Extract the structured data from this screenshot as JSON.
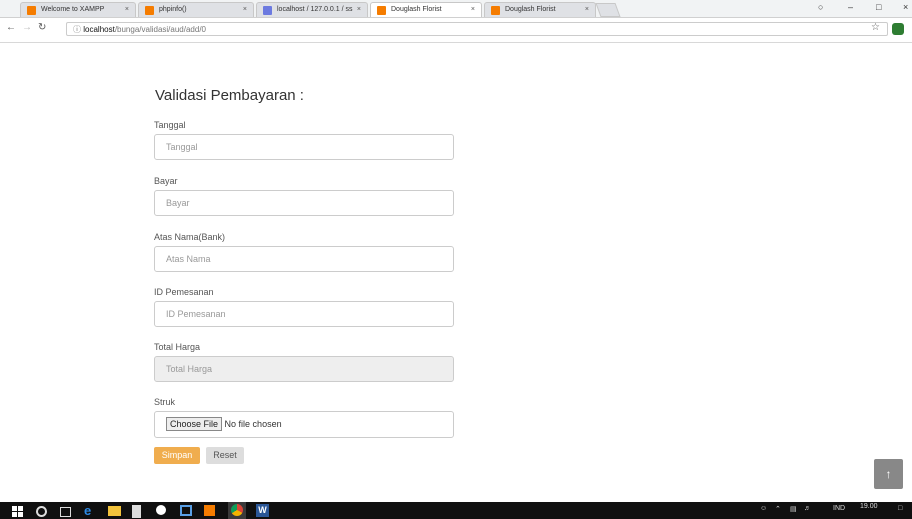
{
  "browser": {
    "tabs": [
      {
        "label": "Welcome to XAMPP",
        "active": false,
        "icon": "xampp-icon"
      },
      {
        "label": "phpinfo()",
        "active": false,
        "icon": "xampp-icon"
      },
      {
        "label": "localhost / 127.0.0.1 / ss",
        "active": false,
        "icon": "phpmyadmin-icon"
      },
      {
        "label": "Douglash Florist",
        "active": true,
        "icon": "xampp-icon"
      },
      {
        "label": "Douglash Florist",
        "active": false,
        "icon": "xampp-icon"
      }
    ],
    "url_host": "localhost",
    "url_path": "/bunga/validasi/aud/add/0"
  },
  "form": {
    "title": "Validasi Pembayaran :",
    "fields": [
      {
        "label": "Tanggal",
        "placeholder": "Tanggal",
        "disabled": false
      },
      {
        "label": "Bayar",
        "placeholder": "Bayar",
        "disabled": false
      },
      {
        "label": "Atas Nama(Bank)",
        "placeholder": "Atas Nama",
        "disabled": false
      },
      {
        "label": "ID Pemesanan",
        "placeholder": "ID Pemesanan",
        "disabled": false
      },
      {
        "label": "Total Harga",
        "placeholder": "Total Harga",
        "disabled": true
      }
    ],
    "file": {
      "label": "Struk",
      "button": "Choose File",
      "status": "No file chosen"
    },
    "save_label": "Simpan",
    "reset_label": "Reset"
  },
  "scroll_top_label": "↑",
  "taskbar": {
    "lang": "IND",
    "time": "19.00"
  },
  "colors": {
    "save_button": "#f0ad4e",
    "reset_button": "#dddddd",
    "taskbar": "#101010"
  }
}
